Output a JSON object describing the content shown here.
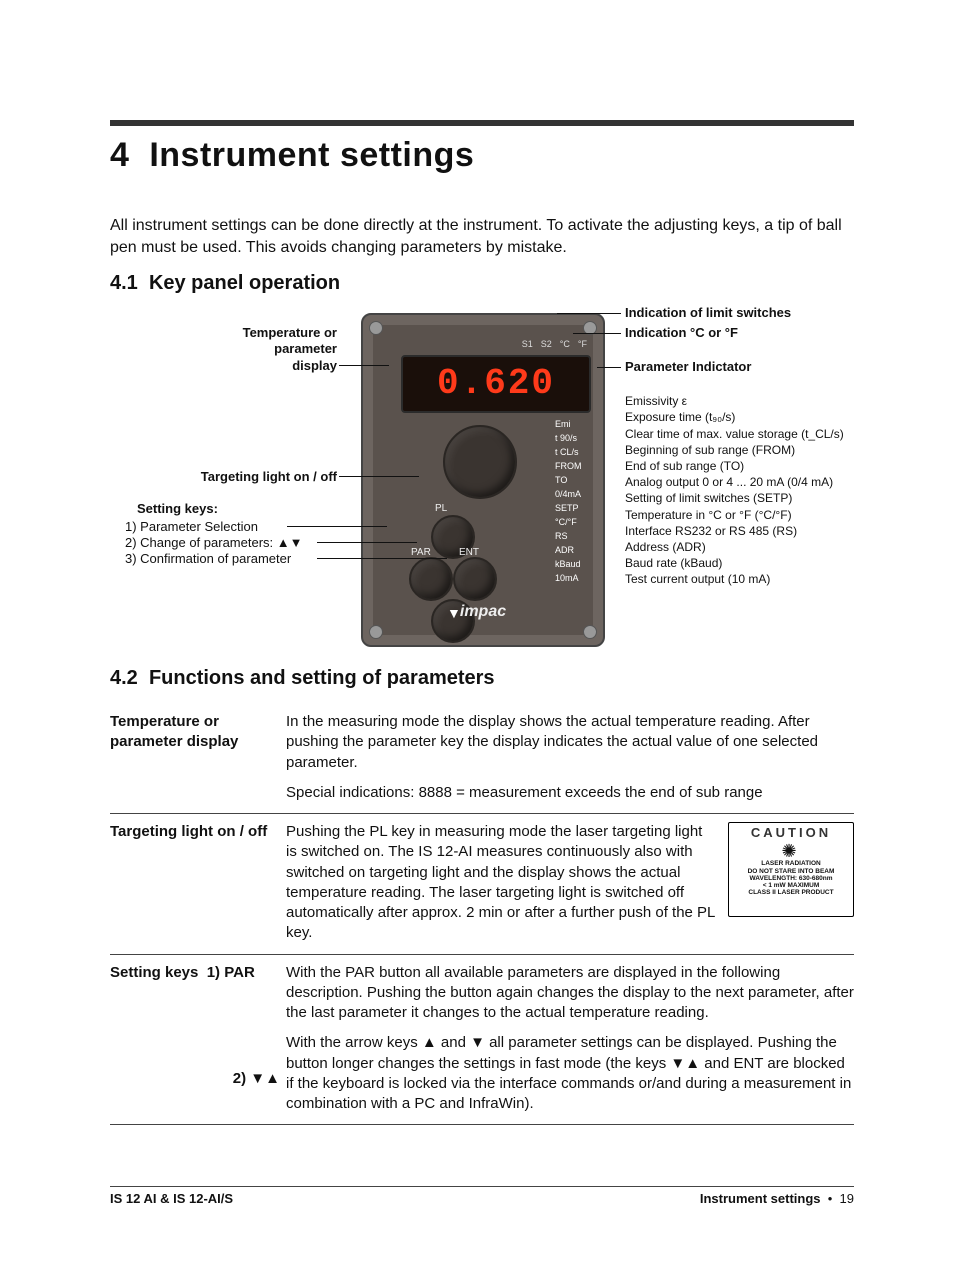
{
  "chapter": {
    "number": "4",
    "title": "Instrument settings",
    "intro": "All instrument settings can be done directly at the instrument. To activate the adjusting keys, a tip of ball pen must be used. This avoids changing parameters by mistake."
  },
  "sections": {
    "s41": {
      "number": "4.1",
      "title": "Key panel operation"
    },
    "s42": {
      "number": "4.2",
      "title": "Functions and setting of parameters"
    }
  },
  "diagram": {
    "readout": "0.620",
    "top_row": {
      "s1": "S1",
      "s2": "S2",
      "degC": "°C",
      "degF": "°F"
    },
    "buttons": {
      "pl": "PL",
      "par": "PAR",
      "ent": "ENT",
      "up": "▲",
      "down": "▼"
    },
    "brand": "impac",
    "side_labels": [
      "Emi",
      "t 90/s",
      "t CL/s",
      "FROM",
      "TO",
      "0/4mA",
      "SETP",
      "°C/°F",
      "RS",
      "ADR",
      "kBaud",
      "10mA"
    ],
    "callouts_left": {
      "display": "Temperature or\nparameter\ndisplay",
      "targeting": "Targeting light on / off",
      "setkeys_hdr": "Setting keys:",
      "setkeys_1": "1) Parameter Selection",
      "setkeys_2": "2) Change of parameters: ▲▼",
      "setkeys_3": "3) Confirmation of parameter"
    },
    "callouts_right": {
      "limits": "Indication of limit switches",
      "unit": "Indication °C or °F",
      "param_ind": "Parameter Indictator",
      "param_list": [
        "Emissivity ε",
        "Exposure time (t₉₀/s)",
        "Clear time of max. value storage (t_CL/s)",
        "Beginning of sub range (FROM)",
        "End of sub range (TO)",
        "Analog output 0 or 4 ... 20 mA (0/4 mA)",
        "Setting of limit switches (SETP)",
        "Temperature in °C or °F (°C/°F)",
        "Interface RS232 or RS 485 (RS)",
        "Address (ADR)",
        "Baud rate (kBaud)",
        "Test current output (10 mA)"
      ]
    }
  },
  "params": {
    "row1": {
      "label": "Temperature or parameter display",
      "p1": "In the measuring mode the display shows the actual temperature reading. After pushing the parameter key the display indicates the actual value of one selected parameter.",
      "p2": "Special indications:  8888 = measurement exceeds the end of sub range"
    },
    "row2": {
      "label": "Targeting light on / off",
      "p1": "Pushing the PL key in measuring mode the laser targeting light is switched on. The IS 12-AI measures continuously also with switched on targeting light and the display shows the actual temperature reading. The laser targeting light is switched off automatically after approx. 2 min or after a further push of the PL key.",
      "caution": {
        "hdr": "CAUTION",
        "l1": "LASER RADIATION",
        "l2": "DO NOT STARE INTO BEAM",
        "l3": "WAVELENGTH: 630-680nm",
        "l4": "< 1 mW MAXIMUM",
        "l5": "CLASS II LASER PRODUCT"
      }
    },
    "row3": {
      "label": "Setting keys",
      "sub1_label": "1) PAR",
      "sub1_text": "With the PAR button all available parameters are displayed in the following description. Pushing the button again changes the display to the next parameter, after the last parameter it changes to the actual temperature reading.",
      "sub2_label": "2) ▼▲",
      "sub2_text": "With the arrow keys ▲ and ▼ all parameter settings can be displayed. Pushing the button longer changes the settings in fast mode (the keys ▼▲ and ENT are blocked if the keyboard is locked via the interface commands or/and during a measurement in combination with a PC and InfraWin)."
    }
  },
  "footer": {
    "left": "IS 12 AI & IS 12-AI/S",
    "right_section": "Instrument settings",
    "bullet": "•",
    "page": "19"
  }
}
